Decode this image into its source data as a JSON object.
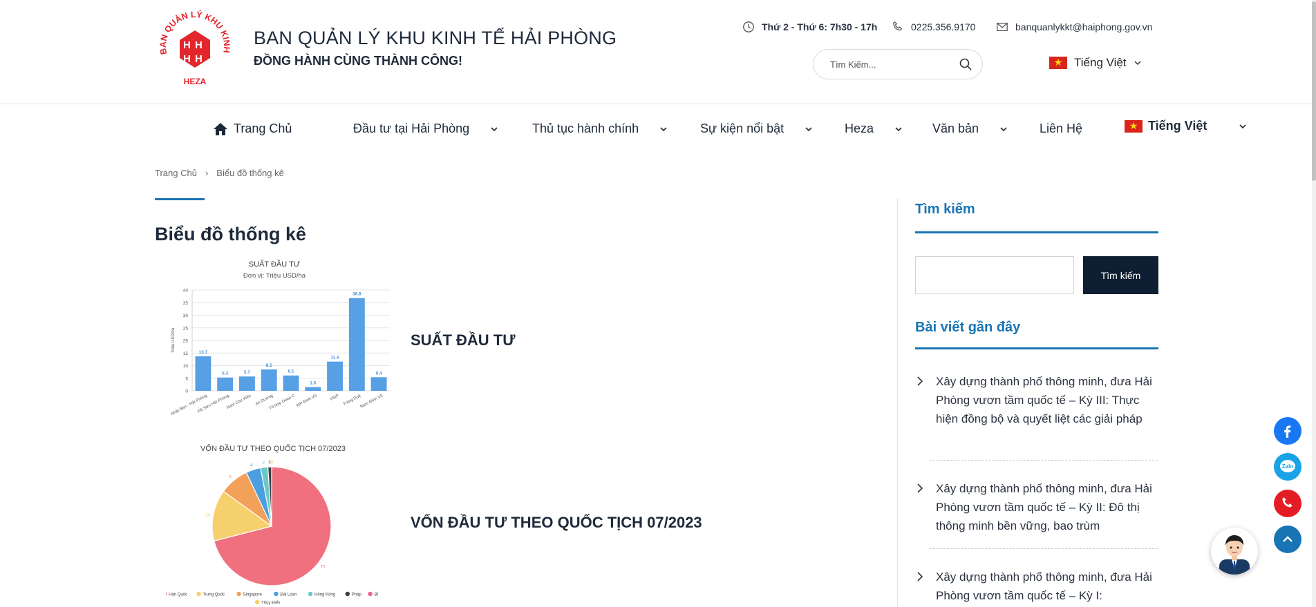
{
  "header": {
    "logo_text": "BAN QUẢN LÝ KHU KINH TẾ HẢI PHÒNG",
    "logo_abbr": "HEZA",
    "title": "BAN QUẢN LÝ KHU KINH TẾ HẢI PHÒNG",
    "slogan": "ĐỒNG HÀNH CÙNG THÀNH CÔNG!",
    "hours": "Thứ 2 - Thứ 6: 7h30 - 17h",
    "phone": "0225.356.9170",
    "email": "banquanlykkt@haiphong.gov.vn",
    "search_placeholder": "Tìm Kiếm...",
    "language": "Tiếng Việt"
  },
  "nav": {
    "items": [
      {
        "label": "Trang Chủ"
      },
      {
        "label": "Đầu tư tại Hải Phòng"
      },
      {
        "label": "Thủ tục hành chính"
      },
      {
        "label": "Sự kiện nổi bật"
      },
      {
        "label": "Heza"
      },
      {
        "label": "Văn bản"
      },
      {
        "label": "Liên Hệ"
      }
    ],
    "language": "Tiếng Việt"
  },
  "breadcrumb": {
    "home": "Trang Chủ",
    "separator": "›",
    "current": "Biểu đồ thống kê"
  },
  "page": {
    "title": "Biểu đồ thống kê",
    "chart1_caption": "SUẤT ĐẦU TƯ",
    "chart2_caption": "VỐN ĐẦU TƯ THEO QUỐC TỊCH 07/2023"
  },
  "chart_data": [
    {
      "type": "bar",
      "title": "SUẤT ĐẦU TƯ",
      "subtitle": "Đơn vị: Triệu USD/ha",
      "ylabel": "Triệu USD/ha",
      "xlabel": "",
      "ylim": [
        0,
        40
      ],
      "yticks": [
        0,
        5,
        10,
        15,
        20,
        25,
        30,
        35,
        40
      ],
      "grid": true,
      "color": "#57a0e5",
      "categories": [
        "Nhật Bản - Hải Phòng",
        "Đồ Sơn Hải Phòng",
        "Nam Cầu Kiền",
        "An Dương",
        "Tổ hợp Deep C",
        "MP Đình Vũ",
        "VSIP",
        "Tràng Duệ",
        "Nam Đình Vũ"
      ],
      "values": [
        13.7,
        5.3,
        5.7,
        8.5,
        6.1,
        1.5,
        11.6,
        36.8,
        5.4
      ]
    },
    {
      "type": "pie",
      "title": "VỐN ĐẦU TƯ THEO QUỐC TỊCH 07/2023",
      "categories": [
        "Hàn Quốc",
        "Trung Quốc",
        "Singapore",
        "Đài Loan",
        "Hồng Kông",
        "Pháp",
        "Bỉ",
        "Thụy Điển"
      ],
      "values": [
        71,
        14,
        8,
        4,
        2,
        1,
        0,
        0
      ],
      "value_labels": [
        "71",
        "14",
        "8",
        "4",
        "2",
        "1",
        "0",
        "0"
      ],
      "colors": [
        "#f0707f",
        "#f7d06e",
        "#f2a158",
        "#4b9ee0",
        "#6cc8c8",
        "#3a3f47",
        "#f06292",
        "#f7d06e"
      ],
      "legend": "bottom"
    }
  ],
  "sidebar": {
    "search_heading": "Tìm kiếm",
    "search_button": "Tìm kiếm",
    "recent_heading": "Bài viết gần đây",
    "posts": [
      {
        "title": "Xây dựng thành phố thông minh, đưa Hải Phòng vươn tầm quốc tế – Kỳ III: Thực hiện đồng bộ và quyết liệt các giải pháp"
      },
      {
        "title": "Xây dựng thành phố thông minh, đưa Hải Phòng vươn tầm quốc tế – Kỳ II: Đô thị thông minh bền vững, bao trùm"
      },
      {
        "title": "Xây dựng thành phố thông minh, đưa Hải Phòng vươn tầm quốc tế – Kỳ I:"
      }
    ]
  },
  "floating": {
    "zalo_label": "Zalo"
  },
  "colors": {
    "accent": "#1874b4",
    "dark_button": "#0e1f33",
    "logo_red": "#e2262c"
  }
}
